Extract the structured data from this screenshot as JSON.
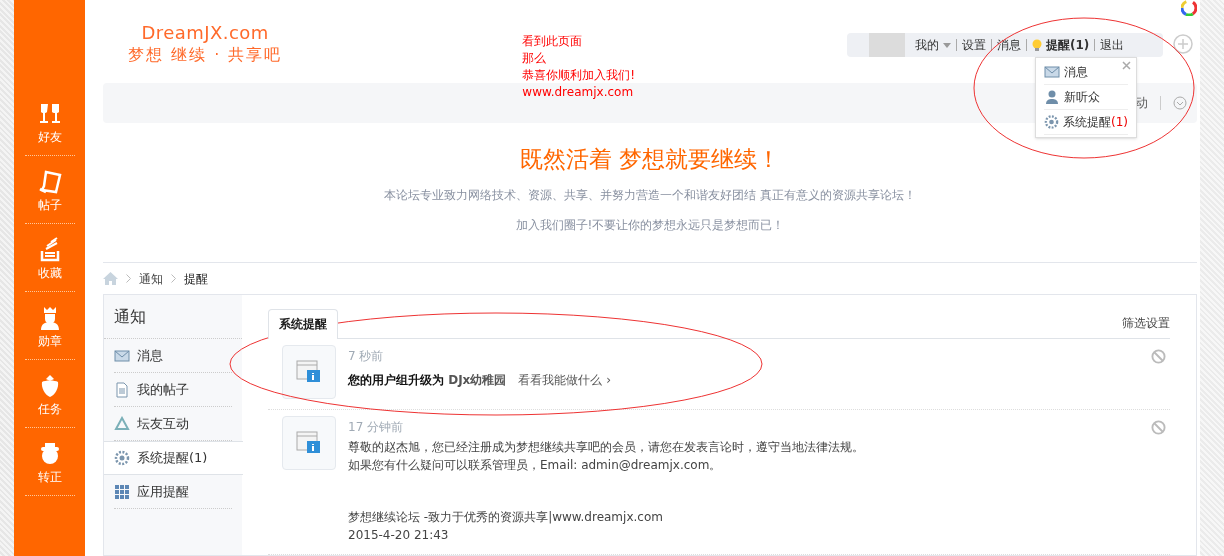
{
  "sidebar": {
    "items": [
      {
        "label": "好友"
      },
      {
        "label": "帖子"
      },
      {
        "label": "收藏"
      },
      {
        "label": "勋章"
      },
      {
        "label": "任务"
      },
      {
        "label": "转正"
      }
    ]
  },
  "logo": {
    "title": "DreamJX.com",
    "subtitle": "梦想 继续 · 共享吧"
  },
  "annotation": {
    "lines": [
      "看到此页面",
      "那么",
      "恭喜你顺利加入我们!",
      "www.dreamjx.com"
    ]
  },
  "top_nav": {
    "items": [
      {
        "kind": "menu",
        "label": "我的"
      },
      {
        "kind": "link",
        "label": "设置"
      },
      {
        "kind": "link",
        "label": "消息"
      },
      {
        "kind": "alert",
        "label": "提醒(1)"
      },
      {
        "kind": "link",
        "label": "退出"
      }
    ]
  },
  "dropdown": {
    "items": [
      {
        "kind": "mail",
        "label": "消息"
      },
      {
        "kind": "user",
        "label": "新听众"
      },
      {
        "kind": "gear",
        "label": "系统提醒",
        "count": "(1)"
      }
    ]
  },
  "toolbar": {
    "partial_label": "动"
  },
  "banner": {
    "title": "既然活着 梦想就要继续！",
    "lines": [
      "本论坛专业致力网络技术、资源、共享、并努力营造一个和谐友好团结 真正有意义的资源共享论坛！",
      "加入我们圈子!不要让你的梦想永远只是梦想而已！"
    ]
  },
  "breadcrumb": [
    "通知",
    "提醒"
  ],
  "notice_nav": {
    "title": "通知",
    "items": [
      {
        "kind": "mail",
        "label": "消息",
        "selected": false
      },
      {
        "kind": "doc",
        "label": "我的帖子",
        "selected": false
      },
      {
        "kind": "recycle",
        "label": "坛友互动",
        "selected": false
      },
      {
        "kind": "gear",
        "label": "系统提醒(1)",
        "selected": true
      },
      {
        "kind": "grid",
        "label": "应用提醒",
        "selected": false
      }
    ]
  },
  "tabs": [
    {
      "label": "系统提醒",
      "selected": true
    }
  ],
  "filter_link": "筛选设置",
  "notifications": [
    {
      "kind": "upgrade",
      "time": "7 秒前",
      "message": "您的用户组升级为",
      "group": "DJx幼稚园",
      "link": "看看我能做什么 ›"
    },
    {
      "kind": "welcome",
      "time": "17 分钟前",
      "lines": [
        "尊敬的赵杰旭，您已经注册成为梦想继续共享吧的会员，请您在发表言论时，遵守当地法律法规。",
        "如果您有什么疑问可以联系管理员，Email: admin@dreamjx.com。"
      ],
      "footer": [
        "梦想继续论坛 -致力于优秀的资源共享|www.dreamjx.com",
        "2015-4-20 21:43"
      ]
    }
  ]
}
